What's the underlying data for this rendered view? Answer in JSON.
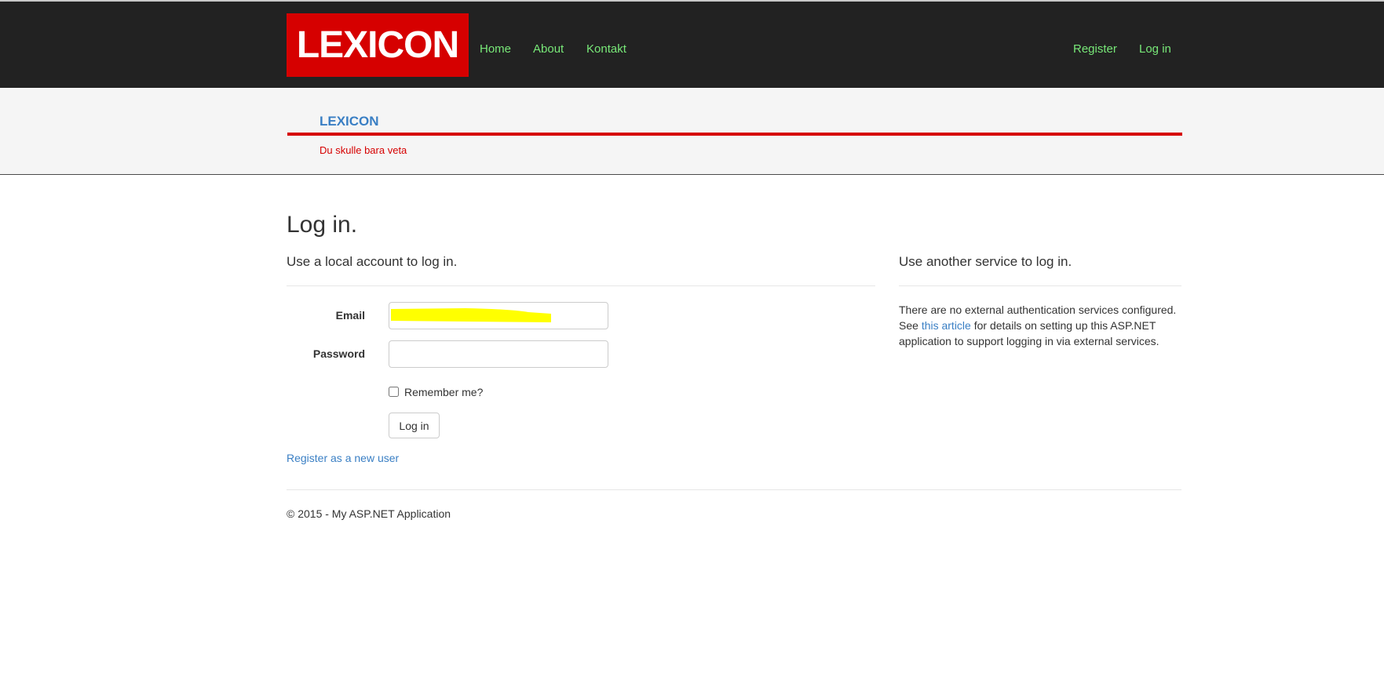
{
  "navbar": {
    "brand": "LEXICON",
    "links": [
      "Home",
      "About",
      "Kontakt"
    ],
    "register": "Register",
    "login": "Log in"
  },
  "banner": {
    "title": "LEXICON",
    "tagline": "Du skulle bara veta"
  },
  "page": {
    "title": "Log in.",
    "local_heading": "Use a local account to log in.",
    "external_heading": "Use another service to log in."
  },
  "form": {
    "email_label": "Email",
    "email_value": "",
    "password_label": "Password",
    "password_value": "",
    "remember_label": "Remember me?",
    "remember_checked": false,
    "login_button": "Log in",
    "register_link": "Register as a new user"
  },
  "external": {
    "text_before": "There are no external authentication services configured. See ",
    "link_text": "this article",
    "text_after": " for details on setting up this ASP.NET application to support logging in via external services."
  },
  "footer": {
    "text": "© 2015 - My ASP.NET Application"
  },
  "colors": {
    "navbar_bg": "#222222",
    "brand_red": "#d60000",
    "nav_link": "#78e878",
    "link_blue": "#3a7fc4",
    "highlight_yellow": "#ffff00"
  }
}
